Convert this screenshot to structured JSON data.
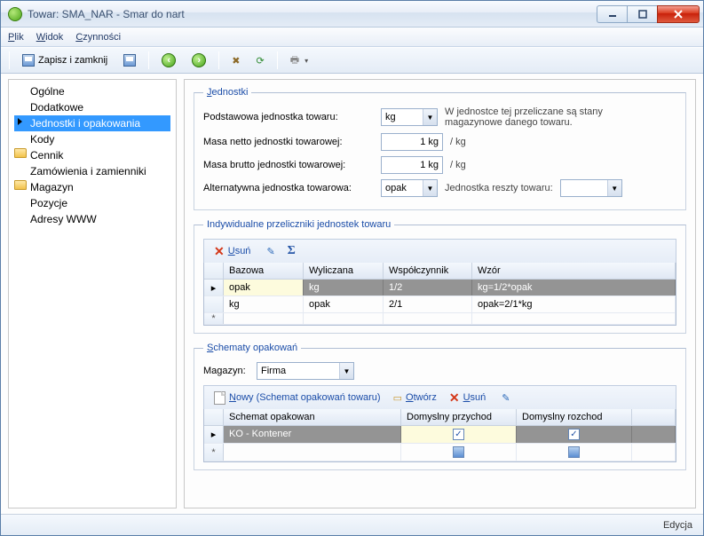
{
  "window": {
    "title": "Towar: SMA_NAR - Smar do nart"
  },
  "menubar": {
    "plik": "Plik",
    "widok": "Widok",
    "czynnosci": "Czynności"
  },
  "toolbar": {
    "saveClose": "Zapisz i zamknij"
  },
  "sidebar": {
    "items": [
      {
        "label": "Ogólne",
        "icon": null,
        "selected": false
      },
      {
        "label": "Dodatkowe",
        "icon": null,
        "selected": false
      },
      {
        "label": "Jednostki i opakowania",
        "icon": "caret",
        "selected": true
      },
      {
        "label": "Kody",
        "icon": null,
        "selected": false
      },
      {
        "label": "Cennik",
        "icon": "folder",
        "selected": false
      },
      {
        "label": "Zamówienia i zamienniki",
        "icon": null,
        "selected": false
      },
      {
        "label": "Magazyn",
        "icon": "folder",
        "selected": false
      },
      {
        "label": "Pozycje",
        "icon": null,
        "selected": false
      },
      {
        "label": "Adresy WWW",
        "icon": null,
        "selected": false
      }
    ]
  },
  "units": {
    "legend": "Jednostki",
    "base_label": "Podstawowa jednostka towaru:",
    "base_value": "kg",
    "base_info": "W jednostce tej przeliczane są stany magazynowe danego towaru.",
    "netto_label": "Masa netto jednostki towarowej:",
    "netto_value": "1 kg",
    "netto_after": "/  kg",
    "brutto_label": "Masa brutto jednostki towarowej:",
    "brutto_value": "1 kg",
    "brutto_after": "/  kg",
    "alt_label": "Alternatywna jednostka towarowa:",
    "alt_value": "opak",
    "rest_label": "Jednostka reszty towaru:",
    "rest_value": ""
  },
  "conv": {
    "legend": "Indywidualne przeliczniki jednostek towaru",
    "delete": "Usuń",
    "headers": {
      "bazowa": "Bazowa",
      "wyliczana": "Wyliczana",
      "wsp": "Współczynnik",
      "wzor": "Wzór"
    },
    "rows": [
      {
        "bazowa": "opak",
        "wyliczana": "kg",
        "wsp": "1/2",
        "wzor": "kg=1/2*opak",
        "selected": true,
        "highlight": true
      },
      {
        "bazowa": "kg",
        "wyliczana": "opak",
        "wsp": "2/1",
        "wzor": "opak=2/1*kg",
        "selected": false,
        "highlight": false
      }
    ]
  },
  "pack": {
    "legend": "Schematy opakowań",
    "magazyn_label": "Magazyn:",
    "magazyn_value": "Firma",
    "new": "Nowy (Schemat opakowań towaru)",
    "open": "Otwórz",
    "delete": "Usuń",
    "headers": {
      "schemat": "Schemat opakowan",
      "przychod": "Domyslny przychod",
      "rozchod": "Domyslny rozchod"
    },
    "rows": [
      {
        "schemat": "KO - Kontener",
        "przychod": true,
        "rozchod": true,
        "selected": true
      }
    ]
  },
  "statusbar": {
    "text": "Edycja"
  }
}
